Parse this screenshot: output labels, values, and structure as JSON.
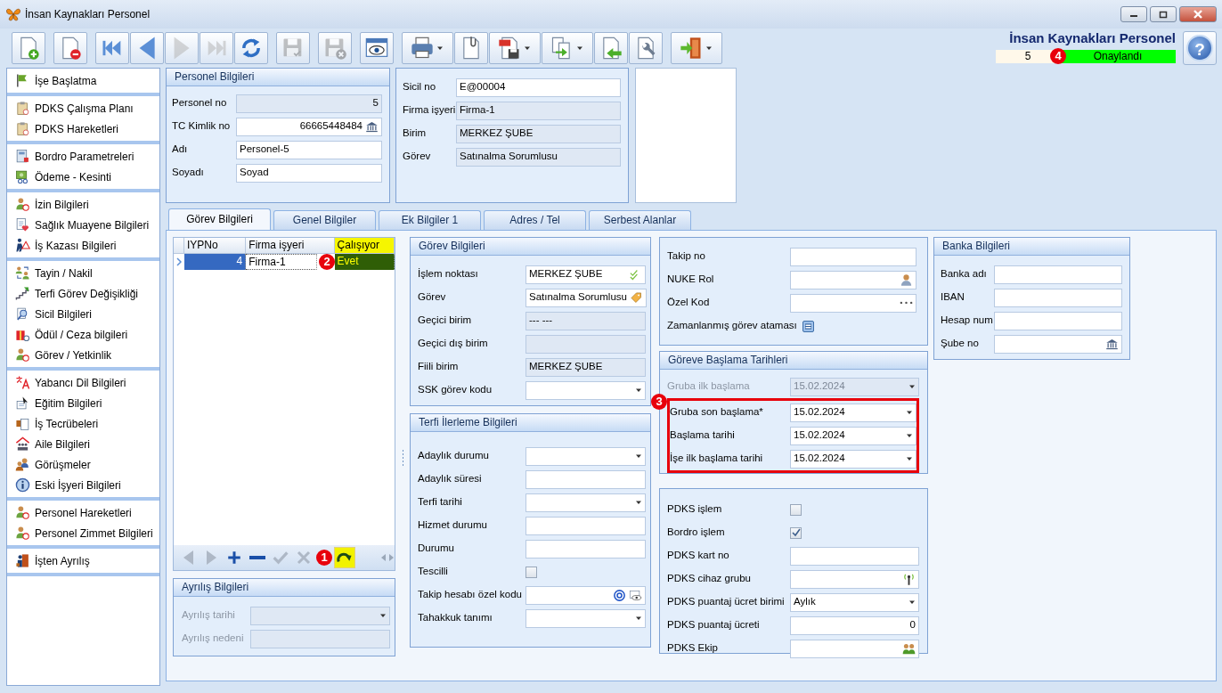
{
  "window": {
    "title": "İnsan Kaynakları Personel"
  },
  "toolbar": {
    "groups": [
      [
        {
          "kind": "new",
          "disabled": false,
          "dropdown": false
        }
      ],
      [
        {
          "kind": "delete",
          "disabled": false,
          "dropdown": false
        }
      ],
      [
        {
          "kind": "first",
          "disabled": false,
          "dropdown": false
        },
        {
          "kind": "prev",
          "disabled": false,
          "dropdown": false
        },
        {
          "kind": "next",
          "disabled": true,
          "dropdown": false
        },
        {
          "kind": "last",
          "disabled": true,
          "dropdown": false
        },
        {
          "kind": "refresh",
          "disabled": false,
          "dropdown": false
        }
      ],
      [
        {
          "kind": "save",
          "disabled": true,
          "dropdown": false
        }
      ],
      [
        {
          "kind": "savecancel",
          "disabled": true,
          "dropdown": false
        }
      ],
      [
        {
          "kind": "preview",
          "disabled": false,
          "dropdown": false
        }
      ],
      [
        {
          "kind": "print",
          "disabled": false,
          "dropdown": true
        },
        {
          "kind": "attach",
          "disabled": false,
          "dropdown": false
        },
        {
          "kind": "pdf",
          "disabled": false,
          "dropdown": true
        },
        {
          "kind": "copy",
          "disabled": false,
          "dropdown": true
        },
        {
          "kind": "import",
          "disabled": false,
          "dropdown": false
        },
        {
          "kind": "tools",
          "disabled": false,
          "dropdown": false
        }
      ],
      [
        {
          "kind": "exit",
          "disabled": false,
          "dropdown": true
        }
      ]
    ]
  },
  "header": {
    "title": "İnsan Kaynakları Personel",
    "record_no": "5",
    "status": "Onaylandı",
    "callout": "4",
    "help": "?"
  },
  "sidebar": {
    "groups": [
      [
        {
          "label": "İşe Başlatma",
          "kind": "flag"
        }
      ],
      [
        {
          "label": "PDKS Çalışma Planı",
          "kind": "clipboard"
        },
        {
          "label": "PDKS Hareketleri",
          "kind": "clipboard"
        }
      ],
      [
        {
          "label": "Bordro Parametreleri",
          "kind": "calc"
        },
        {
          "label": "Ödeme - Kesinti",
          "kind": "money"
        }
      ],
      [
        {
          "label": "İzin Bilgileri",
          "kind": "person"
        },
        {
          "label": "Sağlık Muayene Bilgileri",
          "kind": "health"
        },
        {
          "label": "İş Kazası Bilgileri",
          "kind": "accident"
        }
      ],
      [
        {
          "label": "Tayin / Nakil",
          "kind": "transfer"
        },
        {
          "label": "Terfi Görev Değişikliği",
          "kind": "stairs"
        },
        {
          "label": "Sicil Bilgileri",
          "kind": "search"
        },
        {
          "label": "Ödül / Ceza bilgileri",
          "kind": "gift"
        },
        {
          "label": "Görev / Yetkinlik",
          "kind": "person"
        }
      ],
      [
        {
          "label": "Yabancı Dil Bilgileri",
          "kind": "language"
        },
        {
          "label": "Eğitim Bilgileri",
          "kind": "education"
        },
        {
          "label": "İş Tecrübeleri",
          "kind": "briefcase"
        },
        {
          "label": "Aile Bilgileri",
          "kind": "family"
        },
        {
          "label": "Görüşmeler",
          "kind": "meeting"
        },
        {
          "label": "Eski İşyeri Bilgileri",
          "kind": "info"
        }
      ],
      [
        {
          "label": "Personel Hareketleri",
          "kind": "person"
        },
        {
          "label": "Personel Zimmet Bilgileri",
          "kind": "person"
        }
      ],
      [
        {
          "label": "İşten Ayrılış",
          "kind": "exitperson"
        }
      ]
    ]
  },
  "personel": {
    "title": "Personel Bilgileri",
    "fields": [
      {
        "label": "Personel no",
        "value": "5",
        "kind": "number",
        "readonly": true,
        "disabled": false
      },
      {
        "label": "TC Kimlik no",
        "value": "66665448484",
        "kind": "number",
        "readonly": false,
        "disabled": false,
        "buttons": [
          {
            "kind": "bank"
          }
        ]
      },
      {
        "label": "Adı",
        "value": "Personel-5",
        "kind": "text",
        "readonly": false,
        "disabled": false
      },
      {
        "label": "Soyadı",
        "value": "Soyad",
        "kind": "text",
        "readonly": false,
        "disabled": false
      }
    ]
  },
  "assignment": {
    "fields": [
      {
        "label": "Sicil no",
        "value": "E@00004",
        "kind": "text",
        "readonly": false,
        "disabled": false
      },
      {
        "label": "Firma işyeri",
        "value": "Firma-1",
        "kind": "text",
        "readonly": true,
        "disabled": false
      },
      {
        "label": "Birim",
        "value": "MERKEZ ŞUBE",
        "kind": "text",
        "readonly": true,
        "disabled": false
      },
      {
        "label": "Görev",
        "value": "Satınalma Sorumlusu",
        "kind": "text",
        "readonly": true,
        "disabled": false
      }
    ]
  },
  "tabs": [
    {
      "label": "Görev Bilgileri",
      "selected": true
    },
    {
      "label": "Genel Bilgiler",
      "selected": false
    },
    {
      "label": "Ek Bilgiler 1",
      "selected": false
    },
    {
      "label": "Adres / Tel",
      "selected": false
    },
    {
      "label": "Serbest Alanlar",
      "selected": false
    }
  ],
  "grid": {
    "columns": [
      {
        "label": "IYPNo",
        "highlighted": false
      },
      {
        "label": "Firma işyeri",
        "highlighted": false
      },
      {
        "label": "Çalışıyor",
        "highlighted": true
      }
    ],
    "rows": [
      {
        "selected": true,
        "cells": [
          "4",
          "Firma-1",
          "Evet"
        ],
        "callout": "2"
      }
    ],
    "nav": [
      {
        "kind": "prev",
        "disabled": true,
        "highlighted": false
      },
      {
        "kind": "next",
        "disabled": true,
        "highlighted": false
      },
      {
        "kind": "plus",
        "disabled": false,
        "highlighted": false
      },
      {
        "kind": "minus",
        "disabled": false,
        "highlighted": false
      },
      {
        "kind": "tick",
        "disabled": true,
        "highlighted": false
      },
      {
        "kind": "x",
        "disabled": true,
        "highlighted": false
      },
      {
        "kind": "redo",
        "disabled": false,
        "highlighted": true,
        "callout": "1"
      }
    ]
  },
  "leave": {
    "title": "Ayrılış Bilgileri",
    "fields": [
      {
        "label": "Ayrılış tarihi",
        "kind": "combo",
        "readonly": true,
        "disabled": true
      },
      {
        "label": "Ayrılış nedeni",
        "kind": "text",
        "readonly": true,
        "disabled": true
      }
    ]
  },
  "gorev": {
    "title": "Görev Bilgileri",
    "fields": [
      {
        "label": "İşlem noktası",
        "value": "MERKEZ ŞUBE",
        "kind": "text",
        "readonly": false,
        "disabled": false,
        "buttons": [
          {
            "kind": "check"
          }
        ]
      },
      {
        "label": "Görev",
        "value": "Satınalma Sorumlusu",
        "kind": "text",
        "readonly": false,
        "disabled": false,
        "buttons": [
          {
            "kind": "tag"
          }
        ]
      },
      {
        "label": "Geçici birim",
        "value": "--- ---",
        "kind": "text",
        "readonly": true,
        "disabled": false
      },
      {
        "label": "Geçici dış birim",
        "kind": "text",
        "readonly": true,
        "disabled": false
      },
      {
        "label": "Fiili birim",
        "value": "MERKEZ ŞUBE",
        "kind": "text",
        "readonly": true,
        "disabled": false
      },
      {
        "label": "SSK görev kodu",
        "kind": "combo",
        "readonly": false,
        "disabled": false
      }
    ]
  },
  "terfi": {
    "title": "Terfi İlerleme Bilgileri",
    "fields": [
      {
        "label": "Adaylık durumu",
        "kind": "combo",
        "readonly": false,
        "disabled": false
      },
      {
        "label": "Adaylık süresi",
        "kind": "text",
        "readonly": false,
        "disabled": false
      },
      {
        "label": "Terfi tarihi",
        "kind": "combo",
        "readonly": false,
        "disabled": false
      },
      {
        "label": "Hizmet durumu",
        "kind": "text",
        "readonly": false,
        "disabled": false
      },
      {
        "label": "Durumu",
        "kind": "text",
        "readonly": false,
        "disabled": false
      },
      {
        "label": "Tescilli",
        "kind": "check",
        "checked": false,
        "disabled": false
      },
      {
        "label": "Takip hesabı özel kodu",
        "kind": "text",
        "readonly": false,
        "disabled": false,
        "buttons": [
          {
            "kind": "at"
          },
          {
            "kind": "eye"
          }
        ]
      },
      {
        "label": "Tahakkuk tanımı",
        "kind": "combo",
        "readonly": false,
        "disabled": false
      }
    ]
  },
  "tracking": {
    "fields": [
      {
        "label": "Takip no",
        "kind": "text",
        "readonly": false,
        "disabled": false
      },
      {
        "label": "NUKE Rol",
        "kind": "text",
        "readonly": false,
        "disabled": false,
        "buttons": [
          {
            "kind": "user"
          }
        ]
      },
      {
        "label": "Özel Kod",
        "kind": "text",
        "readonly": false,
        "disabled": false,
        "buttons": [
          {
            "kind": "dots"
          }
        ]
      },
      {
        "label": "Zamanlanmış görev ataması",
        "kind": "button",
        "disabled": false
      }
    ]
  },
  "start_dates": {
    "title": "Göreve Başlama Tarihleri",
    "callout": "3",
    "fields": [
      {
        "label": "Gruba ilk başlama",
        "value": "15.02.2024",
        "kind": "combo",
        "readonly": true,
        "disabled": true,
        "highlighted": false
      },
      {
        "label": "Gruba son başlama*",
        "value": "15.02.2024",
        "kind": "combo",
        "readonly": false,
        "disabled": false,
        "highlighted": true
      },
      {
        "label": "Başlama tarihi",
        "value": "15.02.2024",
        "kind": "combo",
        "readonly": false,
        "disabled": false,
        "highlighted": true
      },
      {
        "label": "İşe ilk başlama tarihi",
        "value": "15.02.2024",
        "kind": "combo",
        "readonly": false,
        "disabled": false,
        "highlighted": true
      }
    ]
  },
  "pdks": {
    "fields": [
      {
        "label": "PDKS işlem",
        "kind": "check",
        "checked": false,
        "disabled": false
      },
      {
        "label": "Bordro işlem",
        "kind": "check",
        "checked": true,
        "disabled": false
      },
      {
        "label": "PDKS kart no",
        "kind": "text",
        "readonly": false,
        "disabled": false
      },
      {
        "label": "PDKS cihaz grubu",
        "kind": "text",
        "readonly": false,
        "disabled": false,
        "buttons": [
          {
            "kind": "antenna"
          }
        ]
      },
      {
        "label": "PDKS puantaj ücret birimi",
        "value": "Aylık",
        "kind": "combo",
        "readonly": false,
        "disabled": false
      },
      {
        "label": "PDKS puantaj ücreti",
        "value": "0",
        "kind": "number",
        "readonly": false,
        "disabled": false
      },
      {
        "label": "PDKS Ekip",
        "kind": "text",
        "readonly": false,
        "disabled": false,
        "buttons": [
          {
            "kind": "people"
          }
        ]
      }
    ]
  },
  "bank": {
    "title": "Banka Bilgileri",
    "fields": [
      {
        "label": "Banka adı",
        "kind": "text",
        "readonly": false,
        "disabled": false
      },
      {
        "label": "IBAN",
        "kind": "text",
        "readonly": false,
        "disabled": false
      },
      {
        "label": "Hesap num",
        "kind": "text",
        "readonly": false,
        "disabled": false
      },
      {
        "label": "Şube no",
        "kind": "text",
        "readonly": false,
        "disabled": false,
        "buttons": [
          {
            "kind": "bank"
          }
        ]
      }
    ]
  }
}
